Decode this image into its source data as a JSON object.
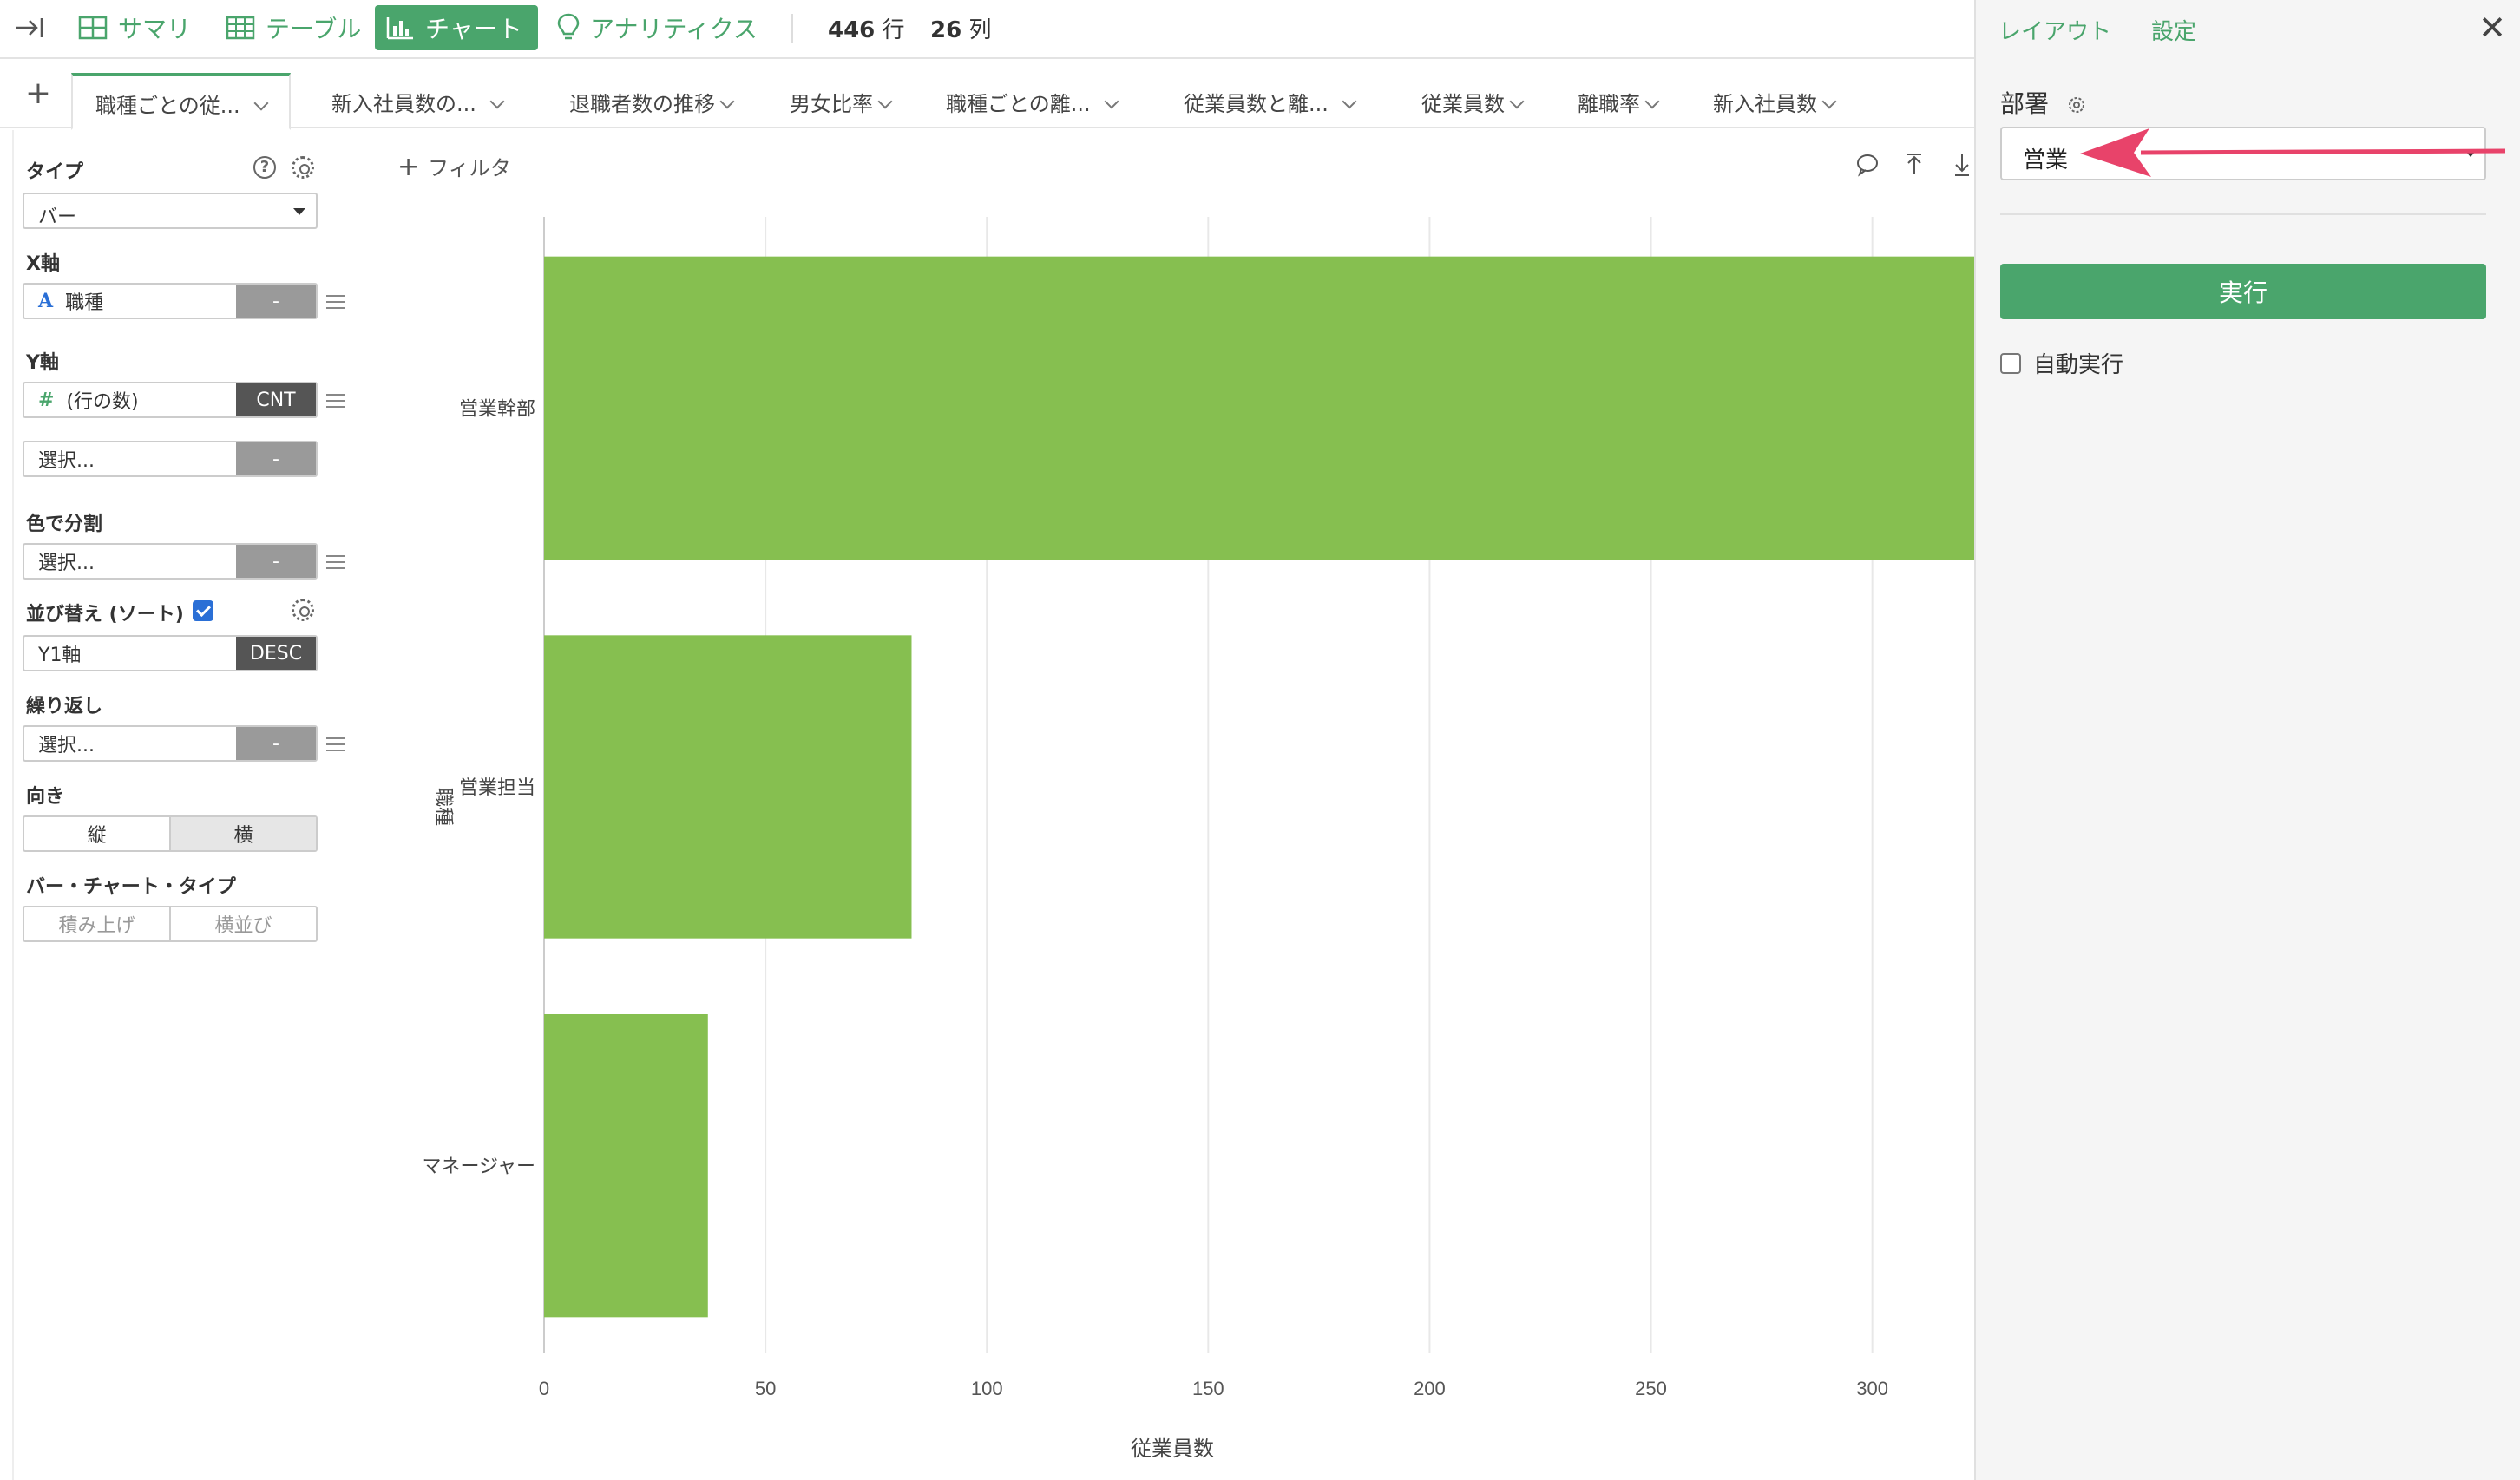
{
  "toolbar": {
    "items": [
      {
        "label": "サマリ",
        "icon": "grid-icon"
      },
      {
        "label": "テーブル",
        "icon": "table-icon"
      },
      {
        "label": "チャート",
        "icon": "bar-chart-icon",
        "active": true
      },
      {
        "label": "アナリティクス",
        "icon": "lightbulb-icon"
      }
    ],
    "rows_value": "446",
    "rows_unit": "行",
    "cols_value": "26",
    "cols_unit": "列"
  },
  "tabs": [
    "職種ごとの従...",
    "新入社員数の...",
    "退職者数の推移",
    "男女比率",
    "職種ごとの離...",
    "従業員数と離...",
    "従業員数",
    "離職率",
    "新入社員数"
  ],
  "left": {
    "type_label": "タイプ",
    "type_value": "バー",
    "x_label": "X軸",
    "x_field": "職種",
    "x_btn": "-",
    "y_label": "Y軸",
    "y_field": "(行の数)",
    "y_btn": "CNT",
    "y2_field": "選択...",
    "y2_btn": "-",
    "color_label": "色で分割",
    "color_field": "選択...",
    "color_btn": "-",
    "sort_label": "並び替え (ソート)",
    "sort_field": "Y1軸",
    "sort_btn": "DESC",
    "repeat_label": "繰り返し",
    "repeat_field": "選択...",
    "repeat_btn": "-",
    "orient_label": "向き",
    "orient_v": "縦",
    "orient_h": "横",
    "bartype_label": "バー・チャート・タイプ",
    "bartype_stack": "積み上げ",
    "bartype_side": "横並び"
  },
  "filter_label": "フィルタ",
  "chart_data": {
    "type": "bar",
    "orientation": "horizontal",
    "categories": [
      "営業幹部",
      "営業担当",
      "マネージャー"
    ],
    "values": [
      323,
      83,
      37
    ],
    "xlabel": "従業員数",
    "ylabel": "職種",
    "xticks": [
      0,
      50,
      100,
      150,
      200,
      250,
      300
    ],
    "xlim": [
      0,
      323
    ],
    "grid": true,
    "bar_color": "#86bf50"
  },
  "right": {
    "layout_link": "レイアウト",
    "settings_link": "設定",
    "close": "✕",
    "param_label": "部署",
    "param_value": "営業",
    "run_label": "実行",
    "auto_label": "自動実行",
    "annotation_color": "#e8436a"
  }
}
